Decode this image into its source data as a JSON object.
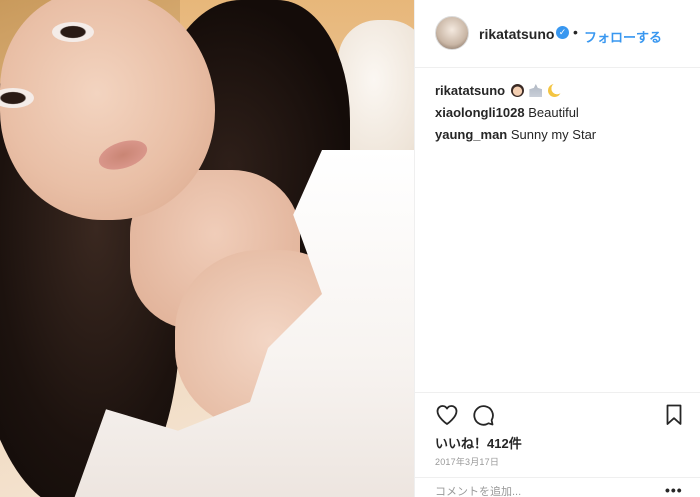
{
  "post": {
    "image_alt": "Selfie photo of a woman with long dark wavy hair wearing a white top",
    "author": {
      "username": "rikatatsuno",
      "verified": true,
      "separator": "•",
      "follow_label": "フォローする"
    },
    "comments": [
      {
        "user": "rikatatsuno",
        "text": "",
        "emojis": [
          "woman-icon",
          "church-icon",
          "moon-icon"
        ]
      },
      {
        "user": "xiaolongli1028",
        "text": "Beautiful"
      },
      {
        "user": "yaung_man",
        "text": "Sunny my Star"
      }
    ],
    "likes_text": "いいね！412件",
    "date_text": "2017年3月17日",
    "add_comment_placeholder": "コメントを追加...",
    "more_label": "•••"
  },
  "colors": {
    "accent": "#3897f0",
    "text": "#262626",
    "muted": "#999999",
    "divider": "#efefef"
  }
}
